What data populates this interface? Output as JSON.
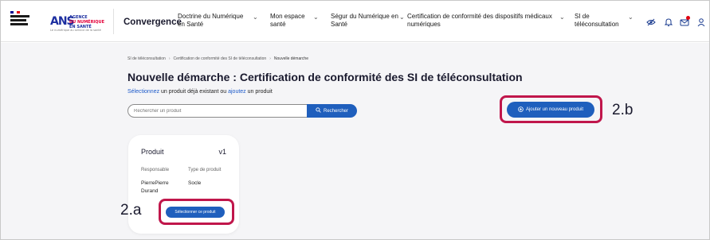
{
  "header": {
    "rf_logo_text": "RÉPUBLIQUE FRANÇAISE",
    "ans_logo": {
      "mark": "ANS",
      "line1": "AGENCE",
      "line2": "DU NUMÉRIQUE",
      "line3": "EN SANTÉ",
      "tagline": "Le numérique au service de la santé"
    },
    "brand": "Convergence",
    "nav": [
      {
        "label_line1": "Doctrine du Numérique",
        "label_line2": "en Santé"
      },
      {
        "label_line1": "Mon espace",
        "label_line2": "santé"
      },
      {
        "label_line1": "Ségur du Numérique en",
        "label_line2": "Santé"
      },
      {
        "label_line1": "Certification de conformité des dispositifs médicaux",
        "label_line2": "numériques"
      },
      {
        "label_line1": "SI de",
        "label_line2": "téléconsultation"
      }
    ],
    "icons": [
      "eye-slash-icon",
      "bell-icon",
      "message-icon",
      "user-icon"
    ]
  },
  "breadcrumb": {
    "item1": "SI de téléconsultation",
    "item2": "Certification de conformité des SI de téléconsultation",
    "current": "Nouvelle démarche",
    "sep": "›"
  },
  "main": {
    "title": "Nouvelle démarche : Certification de conformité des SI de téléconsultation",
    "subtitle_part1": "Sélectionnez",
    "subtitle_part2": " un produit déjà existant ou ",
    "subtitle_part3": "ajoutez",
    "subtitle_part4": " un produit",
    "search": {
      "placeholder": "Rechercher un produit",
      "button_label": "Rechercher"
    },
    "add_button_label": "Ajouter un nouveau produit"
  },
  "card": {
    "title": "Produit",
    "version": "v1",
    "col1_label": "Responsable",
    "col1_value_line1": "PierrePierre",
    "col1_value_line2": "Durand",
    "col2_label": "Type de produit",
    "col2_value": "Socle",
    "select_button_label": "Sélectionner ce produit"
  },
  "annotations": {
    "label_2a": "2.a",
    "label_2b": "2.b",
    "highlight_color": "#c0164b"
  },
  "colors": {
    "primary": "#1f5fbd",
    "link": "#1b59c9",
    "background": "#f5f5f7",
    "title": "#1a1a2e"
  }
}
